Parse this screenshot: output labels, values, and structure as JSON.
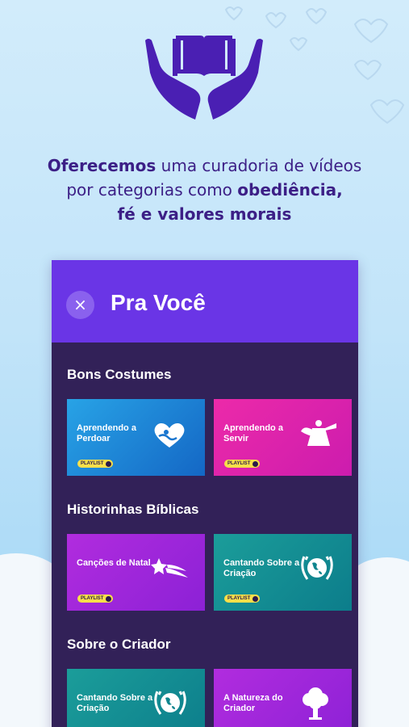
{
  "headline": {
    "part1_bold": "Oferecemos",
    "part2": " uma curadoria de vídeos",
    "part3": "por categorias como ",
    "part4_bold": "obediência,",
    "part5_bold": "fé e valores morais"
  },
  "panel": {
    "title": "Pra Você",
    "close_icon": "×"
  },
  "sections": [
    {
      "title": "Bons Costumes",
      "cards": [
        {
          "label": "Aprendendo a Perdoar",
          "badge": "PLAYLIST",
          "icon": "heart-hug-icon"
        },
        {
          "label": "Aprendendo a Servir",
          "badge": "PLAYLIST",
          "icon": "angel-icon"
        }
      ]
    },
    {
      "title": "Historinhas Bíblicas",
      "cards": [
        {
          "label": "Canções de Natal",
          "badge": "PLAYLIST",
          "icon": "shooting-star-icon"
        },
        {
          "label": "Cantando Sobre a Criação",
          "badge": "PLAYLIST",
          "icon": "globe-hands-icon"
        }
      ]
    },
    {
      "title": "Sobre o Criador",
      "cards": [
        {
          "label": "Cantando Sobre a Criação",
          "icon": "globe-hands-icon"
        },
        {
          "label": "A Natureza do Criador",
          "icon": "tree-icon"
        }
      ]
    }
  ],
  "colors": {
    "accent_purple": "#6a35e6",
    "panel_bg": "#322158",
    "headline_text": "#3c1f86",
    "badge_yellow": "#f7df4a"
  },
  "hero_icon": "hands-holding-book-icon"
}
